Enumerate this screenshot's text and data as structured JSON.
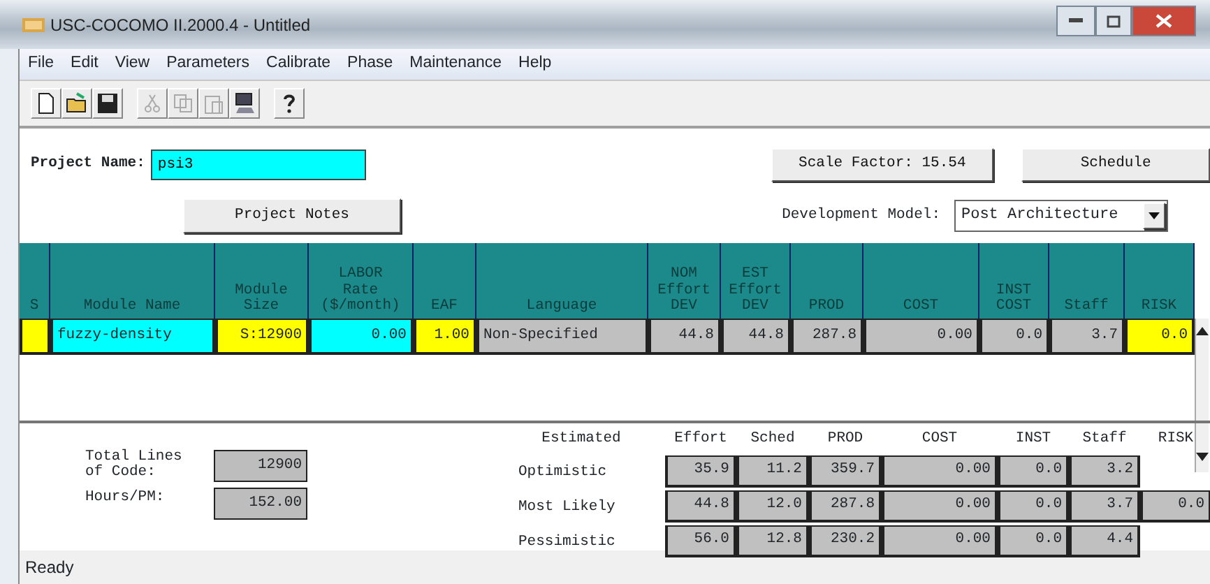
{
  "window": {
    "title": "USC-COCOMO II.2000.4 - Untitled"
  },
  "menu": [
    "File",
    "Edit",
    "View",
    "Parameters",
    "Calibrate",
    "Phase",
    "Maintenance",
    "Help"
  ],
  "toolbar": [
    {
      "kind": "new",
      "disabled": false
    },
    {
      "kind": "open",
      "disabled": false
    },
    {
      "kind": "save",
      "disabled": false
    },
    {
      "kind": "cut",
      "disabled": true
    },
    {
      "kind": "copy",
      "disabled": true
    },
    {
      "kind": "paste",
      "disabled": true
    },
    {
      "kind": "export",
      "disabled": false
    },
    {
      "kind": "help",
      "disabled": false
    }
  ],
  "project": {
    "name_label": "Project Name:",
    "name": "psi3",
    "notes_button": "Project Notes",
    "scale_factor_button": "Scale Factor: 15.54",
    "schedule_button": "Schedule",
    "model_label": "Development Model:",
    "model": "Post Architecture"
  },
  "modules": {
    "columns": [
      "S",
      "Module Name",
      "Module\nSize",
      "LABOR\nRate\n($/month)",
      "EAF",
      "Language",
      "NOM\nEffort\nDEV",
      "EST\nEffort\nDEV",
      "PROD",
      "COST",
      "INST\nCOST",
      "Staff",
      "RISK"
    ],
    "rows": [
      {
        "cells": [
          {
            "color": "#ffff00"
          },
          {
            "text": "fuzzy-density",
            "color": "#00ffff"
          },
          {
            "text": "S:12900",
            "color": "#ffff00"
          },
          {
            "text": "0.00",
            "color": "#00ffff"
          },
          {
            "text": "1.00",
            "color": "#ffff00"
          },
          {
            "text": "Non-Specified",
            "color": "#c0c0c0"
          },
          {
            "text": "44.8",
            "color": "#c0c0c0"
          },
          {
            "text": "44.8",
            "color": "#c0c0c0"
          },
          {
            "text": "287.8",
            "color": "#c0c0c0"
          },
          {
            "text": "0.00",
            "color": "#c0c0c0"
          },
          {
            "text": "0.0",
            "color": "#c0c0c0"
          },
          {
            "text": "3.7",
            "color": "#c0c0c0"
          },
          {
            "text": "0.0",
            "color": "#ffff00"
          }
        ]
      }
    ]
  },
  "totals": {
    "lines_label": "Total Lines\nof Code:",
    "lines": "12900",
    "hours_label": "Hours/PM:",
    "hours": "152.00"
  },
  "estimates": {
    "columns": [
      "Estimated",
      "Effort",
      "Sched",
      "PROD",
      "COST",
      "INST",
      "Staff",
      "RISK"
    ],
    "rows": [
      {
        "label": "Optimistic",
        "values": [
          "35.9",
          "11.2",
          "359.7",
          "0.00",
          "0.0",
          "3.2"
        ]
      },
      {
        "label": "Most Likely",
        "values": [
          "44.8",
          "12.0",
          "287.8",
          "0.00",
          "0.0",
          "3.7",
          "0.0"
        ]
      },
      {
        "label": "Pessimistic",
        "values": [
          "56.0",
          "12.8",
          "230.2",
          "0.00",
          "0.0",
          "4.4"
        ]
      }
    ]
  },
  "status_bar": "Ready"
}
